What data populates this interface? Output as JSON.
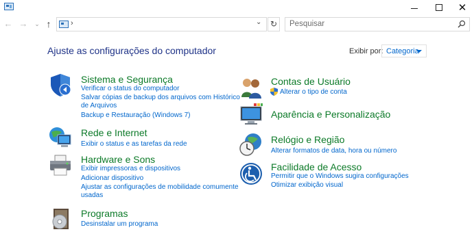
{
  "window": {
    "minimize": "minimize",
    "maximize": "maximize",
    "close": "✕"
  },
  "toolbar": {
    "search_placeholder": "Pesquisar"
  },
  "header": {
    "title": "Ajuste as configurações do computador",
    "view_by_label": "Exibir por:",
    "view_by_value": "Categoria"
  },
  "categories": [
    {
      "title": "Sistema e Segurança",
      "icon": "shield-icon",
      "links": [
        "Verificar o status do computador",
        "Salvar cópias de backup dos arquivos com Histórico",
        "de Arquivos",
        "Backup e Restauração (Windows 7)"
      ]
    },
    {
      "title": "Rede e Internet",
      "icon": "network-icon",
      "links": [
        "Exibir o status e as tarefas da rede"
      ]
    },
    {
      "title": "Hardware e Sons",
      "icon": "printer-icon",
      "links": [
        "Exibir impressoras e dispositivos",
        "Adicionar dispositivo",
        "Ajustar as configurações de mobilidade comumente",
        "usadas"
      ]
    },
    {
      "title": "Programas",
      "icon": "programs-icon",
      "links": [
        "Desinstalar um programa"
      ]
    },
    {
      "title": "Contas de Usuário",
      "icon": "users-icon",
      "links": [
        "Alterar o tipo de conta"
      ]
    },
    {
      "title": "Aparência e Personalização",
      "icon": "display-icon",
      "links": []
    },
    {
      "title": "Relógio e Região",
      "icon": "clock-globe-icon",
      "links": [
        "Alterar formatos de data, hora ou número"
      ]
    },
    {
      "title": "Facilidade de Acesso",
      "icon": "accessibility-icon",
      "links": [
        "Permitir que o Windows sugira configurações",
        "Otimizar exibição visual"
      ]
    }
  ]
}
